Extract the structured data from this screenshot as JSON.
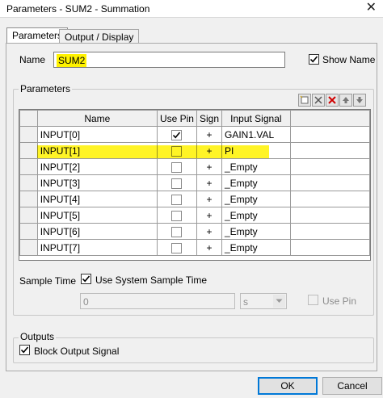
{
  "window": {
    "title": "Parameters - SUM2 - Summation",
    "close_glyph": "✕"
  },
  "tabs": [
    {
      "label": "Parameters",
      "active": true
    },
    {
      "label": "Output / Display",
      "active": false
    }
  ],
  "name_row": {
    "label": "Name",
    "value": "SUM2",
    "show_name_label": "Show Name",
    "show_name_checked": true
  },
  "parameters_group": {
    "label": "Parameters"
  },
  "toolbar": {
    "icons": [
      "new-row-icon",
      "delete-row-icon",
      "delete-all-icon",
      "move-up-icon",
      "move-down-icon"
    ]
  },
  "grid": {
    "headers": [
      "Name",
      "Use Pin",
      "Sign",
      "Input Signal"
    ],
    "rows": [
      {
        "name": "INPUT[0]",
        "use_pin": true,
        "sign": "+",
        "signal": "GAIN1.VAL"
      },
      {
        "name": "INPUT[1]",
        "use_pin": false,
        "sign": "+",
        "signal": "PI",
        "highlighted": true
      },
      {
        "name": "INPUT[2]",
        "use_pin": false,
        "sign": "+",
        "signal": "_Empty"
      },
      {
        "name": "INPUT[3]",
        "use_pin": false,
        "sign": "+",
        "signal": "_Empty"
      },
      {
        "name": "INPUT[4]",
        "use_pin": false,
        "sign": "+",
        "signal": "_Empty"
      },
      {
        "name": "INPUT[5]",
        "use_pin": false,
        "sign": "+",
        "signal": "_Empty"
      },
      {
        "name": "INPUT[6]",
        "use_pin": false,
        "sign": "+",
        "signal": "_Empty"
      },
      {
        "name": "INPUT[7]",
        "use_pin": false,
        "sign": "+",
        "signal": "_Empty"
      }
    ]
  },
  "sample_time": {
    "label": "Sample Time",
    "use_system_label": "Use System Sample Time",
    "use_system_checked": true,
    "value": "0",
    "unit": "s",
    "use_pin_label": "Use Pin"
  },
  "outputs_group": {
    "label": "Outputs",
    "block_output_label": "Block Output Signal",
    "block_output_checked": true
  },
  "buttons": {
    "ok": "OK",
    "cancel": "Cancel"
  },
  "colors": {
    "highlight": "#fff200",
    "default_button_border": "#0078d7"
  }
}
